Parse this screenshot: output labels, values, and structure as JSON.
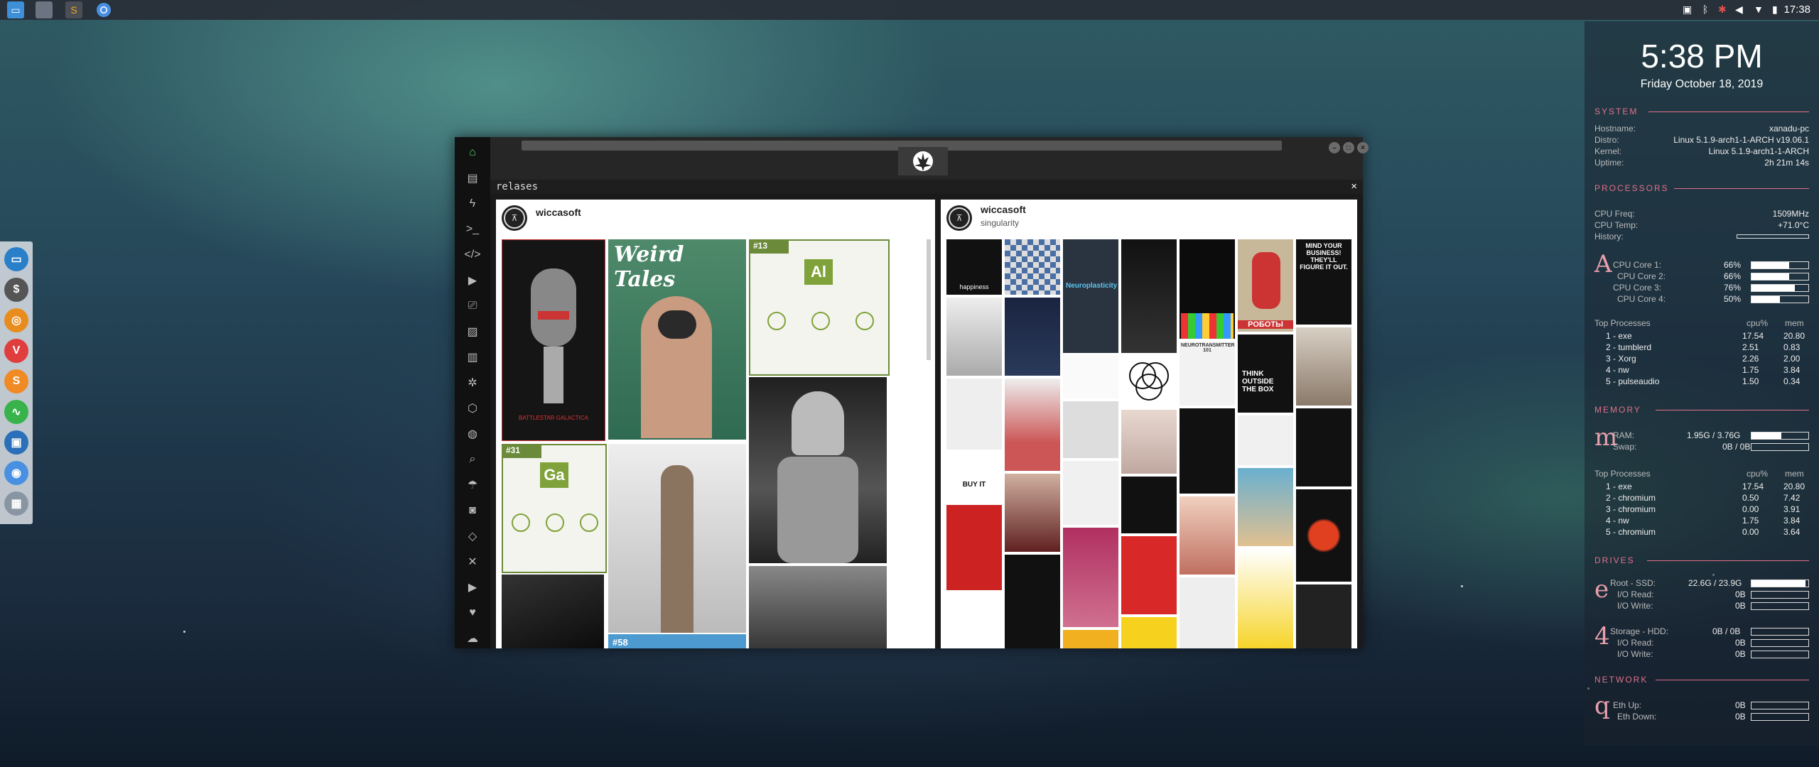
{
  "top_panel": {
    "apps": [
      "file-manager",
      "desktop-switcher",
      "sublime-text",
      "chromium"
    ],
    "clock": "17:38"
  },
  "dock": {
    "items": [
      "file-manager",
      "terminal",
      "ubuntu-launcher",
      "vivaldi",
      "sublime-text",
      "system-monitor",
      "screenshot",
      "chromium",
      "workspaces"
    ]
  },
  "app": {
    "tab_title": "relases",
    "tab_close": "×",
    "nav_icons": [
      "home-icon",
      "document-icon",
      "bolt-icon",
      "terminal-icon",
      "code-icon",
      "play-icon",
      "translate-icon",
      "image-icon",
      "news-icon",
      "aperture-icon",
      "hexagon-icon",
      "globe-icon",
      "search-icon",
      "umbrella-icon",
      "contact-icon",
      "embed-icon",
      "resize-icon",
      "youtube-icon",
      "heart-icon",
      "cloud-icon"
    ],
    "left_post": {
      "username": "wiccasoft"
    },
    "right_post": {
      "username": "wiccasoft",
      "subtitle": "singularity"
    },
    "images": {
      "weird_tales": "Weird Tales",
      "battlestar": "BATTLESTAR GALACTICA",
      "tag13": "#13",
      "al_symbol": "Al",
      "tag31": "#31",
      "ga_symbol": "Ga",
      "tag58": "#58",
      "happiness": "happiness",
      "neuroplasticity": "Neuroplasticity",
      "mind_business": "MIND YOUR BUSINESS! THEY'LL FIGURE IT OUT.",
      "roboty": "РОБОТЫ",
      "neurotransmitters": "NEUROTRANSMITTERS 101",
      "think_outside": "THINK OUTSIDE THE BOX",
      "buy_it": "BUY IT"
    }
  },
  "conky": {
    "time": "5:38 PM",
    "date": "Friday October 18, 2019",
    "system": {
      "title": "SYSTEM",
      "rows": [
        {
          "label": "Hostname:",
          "value": "xanadu-pc"
        },
        {
          "label": "Distro:",
          "value": "Linux 5.1.9-arch1-1-ARCH v19.06.1"
        },
        {
          "label": "Kernel:",
          "value": "Linux 5.1.9-arch1-1-ARCH"
        },
        {
          "label": "Uptime:",
          "value": "2h 21m 14s"
        }
      ]
    },
    "processors": {
      "title": "PROCESSORS",
      "freq_label": "CPU Freq:",
      "freq": "1509MHz",
      "temp_label": "CPU Temp:",
      "temp": "+71.0°C",
      "history_label": "History:",
      "glyph": "A",
      "cores": [
        {
          "label": "CPU Core 1:",
          "value": "66%",
          "fill": 0.66
        },
        {
          "label": "CPU Core 2:",
          "value": "66%",
          "fill": 0.66
        },
        {
          "label": "CPU Core 3:",
          "value": "76%",
          "fill": 0.76
        },
        {
          "label": "CPU Core 4:",
          "value": "50%",
          "fill": 0.5
        }
      ],
      "top_title": "Top Processes",
      "col_cpu": "cpu%",
      "col_mem": "mem",
      "top": [
        {
          "name": "1 - exe",
          "cpu": "17.54",
          "mem": "20.80"
        },
        {
          "name": "2 - tumblerd",
          "cpu": "2.51",
          "mem": "0.83"
        },
        {
          "name": "3 - Xorg",
          "cpu": "2.26",
          "mem": "2.00"
        },
        {
          "name": "4 - nw",
          "cpu": "1.75",
          "mem": "3.84"
        },
        {
          "name": "5 - pulseaudio",
          "cpu": "1.50",
          "mem": "0.34"
        }
      ]
    },
    "memory": {
      "title": "MEMORY",
      "glyph": "m",
      "ram_label": "RAM:",
      "ram": "1.95G / 3.76G",
      "ram_fill": 0.52,
      "swap_label": "Swap:",
      "swap": "0B / 0B",
      "swap_fill": 0,
      "top_title": "Top Processes",
      "col_cpu": "cpu%",
      "col_mem": "mem",
      "top": [
        {
          "name": "1 - exe",
          "cpu": "17.54",
          "mem": "20.80"
        },
        {
          "name": "2 - chromium",
          "cpu": "0.50",
          "mem": "7.42"
        },
        {
          "name": "3 - chromium",
          "cpu": "0.00",
          "mem": "3.91"
        },
        {
          "name": "4 - nw",
          "cpu": "1.75",
          "mem": "3.84"
        },
        {
          "name": "5 - chromium",
          "cpu": "0.00",
          "mem": "3.64"
        }
      ]
    },
    "drives": {
      "title": "DRIVES",
      "root_glyph": "e",
      "root_label": "Root - SSD:",
      "root": "22.6G / 23.9G",
      "root_fill": 0.95,
      "root_read_label": "I/O Read:",
      "root_read": "0B",
      "root_write_label": "I/O Write:",
      "root_write": "0B",
      "storage_glyph": "4",
      "storage_label": "Storage - HDD:",
      "storage": "0B / 0B",
      "storage_fill": 0,
      "storage_read_label": "I/O Read:",
      "storage_read": "0B",
      "storage_write_label": "I/O Write:",
      "storage_write": "0B"
    },
    "network": {
      "title": "NETWORK",
      "glyph": "q",
      "up_label": "Eth Up:",
      "up": "0B",
      "down_label": "Eth Down:",
      "down": "0B"
    }
  }
}
